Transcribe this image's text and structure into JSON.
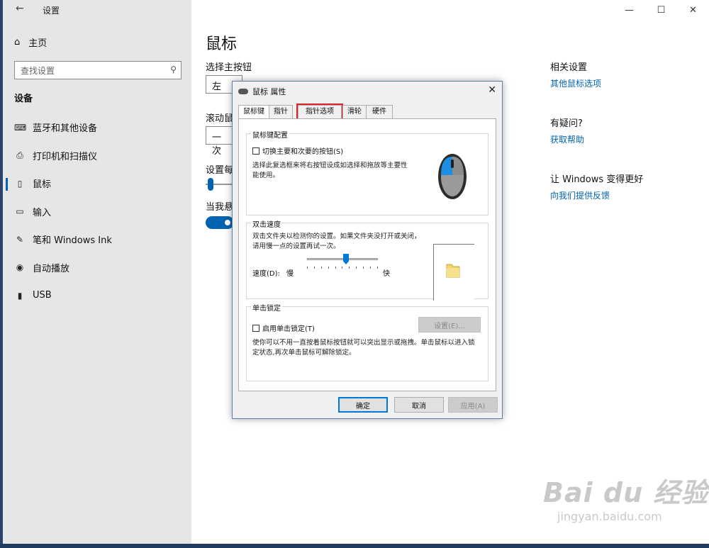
{
  "window": {
    "title": "设置",
    "back_glyph": "←",
    "controls": {
      "minimize": "—",
      "maximize": "☐",
      "close": "✕"
    }
  },
  "sidebar": {
    "home_label": "主页",
    "search_placeholder": "查找设置",
    "section_label": "设备",
    "items": [
      {
        "label": "蓝牙和其他设备",
        "icon": "bluetooth-devices-icon"
      },
      {
        "label": "打印机和扫描仪",
        "icon": "printer-icon"
      },
      {
        "label": "鼠标",
        "icon": "mouse-icon",
        "selected": true
      },
      {
        "label": "输入",
        "icon": "keyboard-icon"
      },
      {
        "label": "笔和 Windows Ink",
        "icon": "pen-icon"
      },
      {
        "label": "自动播放",
        "icon": "autoplay-icon"
      },
      {
        "label": "USB",
        "icon": "usb-icon"
      }
    ]
  },
  "main": {
    "title": "鼠标",
    "primary_button_label": "选择主按钮",
    "primary_button_value": "左",
    "scroll_label": "滚动鼠",
    "scroll_value": "一次",
    "lines_label": "设置每",
    "hover_label": "当我悬"
  },
  "right": {
    "related_head": "相关设置",
    "related_link": "其他鼠标选项",
    "question_head": "有疑问?",
    "question_link": "获取帮助",
    "better_head": "让 Windows 变得更好",
    "better_link": "向我们提供反馈"
  },
  "dialog": {
    "title": "鼠标 属性",
    "close": "✕",
    "tabs": [
      "鼠标键",
      "指针",
      "指针选项",
      "滑轮",
      "硬件"
    ],
    "active_tab_index": 0,
    "highlight_tab_index": 2,
    "group1": {
      "title": "鼠标键配置",
      "checkbox": "切换主要和次要的按钮(S)",
      "desc": "选择此复选框来将右按钮设成如选择和拖放等主要性能使用。"
    },
    "group2": {
      "title": "双击速度",
      "desc": "双击文件夹以检测你的设置。如果文件夹没打开或关闭，请用慢一点的设置再试一次。",
      "speed_label": "速度(D):",
      "slow": "慢",
      "fast": "快",
      "speed_value_fraction": 0.55
    },
    "group3": {
      "title": "单击锁定",
      "checkbox": "启用单击锁定(T)",
      "settings_button": "设置(E)...",
      "desc": "使你可以不用一直按着鼠标按钮就可以突出显示或拖拽。单击鼠标以进入锁定状态,再次单击鼠标可解除锁定。"
    },
    "buttons": {
      "ok": "确定",
      "cancel": "取消",
      "apply": "应用(A)"
    },
    "highlight_color": "#d9252a"
  },
  "watermark": {
    "main": "Bai du 经验",
    "sub": "jingyan.baidu.com"
  },
  "colors": {
    "accent": "#0063b1",
    "link": "#0063b1",
    "sidebar_bg": "#e6e6e6"
  }
}
